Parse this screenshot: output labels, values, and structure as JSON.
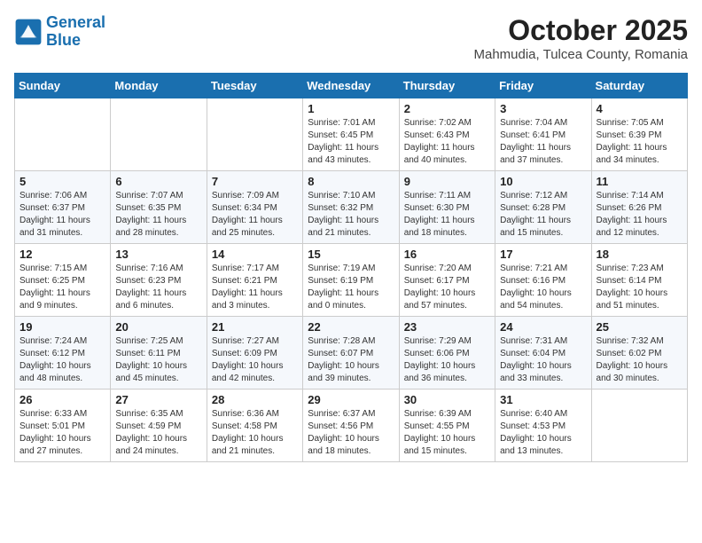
{
  "header": {
    "logo_line1": "General",
    "logo_line2": "Blue",
    "month": "October 2025",
    "location": "Mahmudia, Tulcea County, Romania"
  },
  "days_of_week": [
    "Sunday",
    "Monday",
    "Tuesday",
    "Wednesday",
    "Thursday",
    "Friday",
    "Saturday"
  ],
  "weeks": [
    [
      {
        "day": "",
        "info": ""
      },
      {
        "day": "",
        "info": ""
      },
      {
        "day": "",
        "info": ""
      },
      {
        "day": "1",
        "info": "Sunrise: 7:01 AM\nSunset: 6:45 PM\nDaylight: 11 hours and 43 minutes."
      },
      {
        "day": "2",
        "info": "Sunrise: 7:02 AM\nSunset: 6:43 PM\nDaylight: 11 hours and 40 minutes."
      },
      {
        "day": "3",
        "info": "Sunrise: 7:04 AM\nSunset: 6:41 PM\nDaylight: 11 hours and 37 minutes."
      },
      {
        "day": "4",
        "info": "Sunrise: 7:05 AM\nSunset: 6:39 PM\nDaylight: 11 hours and 34 minutes."
      }
    ],
    [
      {
        "day": "5",
        "info": "Sunrise: 7:06 AM\nSunset: 6:37 PM\nDaylight: 11 hours and 31 minutes."
      },
      {
        "day": "6",
        "info": "Sunrise: 7:07 AM\nSunset: 6:35 PM\nDaylight: 11 hours and 28 minutes."
      },
      {
        "day": "7",
        "info": "Sunrise: 7:09 AM\nSunset: 6:34 PM\nDaylight: 11 hours and 25 minutes."
      },
      {
        "day": "8",
        "info": "Sunrise: 7:10 AM\nSunset: 6:32 PM\nDaylight: 11 hours and 21 minutes."
      },
      {
        "day": "9",
        "info": "Sunrise: 7:11 AM\nSunset: 6:30 PM\nDaylight: 11 hours and 18 minutes."
      },
      {
        "day": "10",
        "info": "Sunrise: 7:12 AM\nSunset: 6:28 PM\nDaylight: 11 hours and 15 minutes."
      },
      {
        "day": "11",
        "info": "Sunrise: 7:14 AM\nSunset: 6:26 PM\nDaylight: 11 hours and 12 minutes."
      }
    ],
    [
      {
        "day": "12",
        "info": "Sunrise: 7:15 AM\nSunset: 6:25 PM\nDaylight: 11 hours and 9 minutes."
      },
      {
        "day": "13",
        "info": "Sunrise: 7:16 AM\nSunset: 6:23 PM\nDaylight: 11 hours and 6 minutes."
      },
      {
        "day": "14",
        "info": "Sunrise: 7:17 AM\nSunset: 6:21 PM\nDaylight: 11 hours and 3 minutes."
      },
      {
        "day": "15",
        "info": "Sunrise: 7:19 AM\nSunset: 6:19 PM\nDaylight: 11 hours and 0 minutes."
      },
      {
        "day": "16",
        "info": "Sunrise: 7:20 AM\nSunset: 6:17 PM\nDaylight: 10 hours and 57 minutes."
      },
      {
        "day": "17",
        "info": "Sunrise: 7:21 AM\nSunset: 6:16 PM\nDaylight: 10 hours and 54 minutes."
      },
      {
        "day": "18",
        "info": "Sunrise: 7:23 AM\nSunset: 6:14 PM\nDaylight: 10 hours and 51 minutes."
      }
    ],
    [
      {
        "day": "19",
        "info": "Sunrise: 7:24 AM\nSunset: 6:12 PM\nDaylight: 10 hours and 48 minutes."
      },
      {
        "day": "20",
        "info": "Sunrise: 7:25 AM\nSunset: 6:11 PM\nDaylight: 10 hours and 45 minutes."
      },
      {
        "day": "21",
        "info": "Sunrise: 7:27 AM\nSunset: 6:09 PM\nDaylight: 10 hours and 42 minutes."
      },
      {
        "day": "22",
        "info": "Sunrise: 7:28 AM\nSunset: 6:07 PM\nDaylight: 10 hours and 39 minutes."
      },
      {
        "day": "23",
        "info": "Sunrise: 7:29 AM\nSunset: 6:06 PM\nDaylight: 10 hours and 36 minutes."
      },
      {
        "day": "24",
        "info": "Sunrise: 7:31 AM\nSunset: 6:04 PM\nDaylight: 10 hours and 33 minutes."
      },
      {
        "day": "25",
        "info": "Sunrise: 7:32 AM\nSunset: 6:02 PM\nDaylight: 10 hours and 30 minutes."
      }
    ],
    [
      {
        "day": "26",
        "info": "Sunrise: 6:33 AM\nSunset: 5:01 PM\nDaylight: 10 hours and 27 minutes."
      },
      {
        "day": "27",
        "info": "Sunrise: 6:35 AM\nSunset: 4:59 PM\nDaylight: 10 hours and 24 minutes."
      },
      {
        "day": "28",
        "info": "Sunrise: 6:36 AM\nSunset: 4:58 PM\nDaylight: 10 hours and 21 minutes."
      },
      {
        "day": "29",
        "info": "Sunrise: 6:37 AM\nSunset: 4:56 PM\nDaylight: 10 hours and 18 minutes."
      },
      {
        "day": "30",
        "info": "Sunrise: 6:39 AM\nSunset: 4:55 PM\nDaylight: 10 hours and 15 minutes."
      },
      {
        "day": "31",
        "info": "Sunrise: 6:40 AM\nSunset: 4:53 PM\nDaylight: 10 hours and 13 minutes."
      },
      {
        "day": "",
        "info": ""
      }
    ]
  ]
}
